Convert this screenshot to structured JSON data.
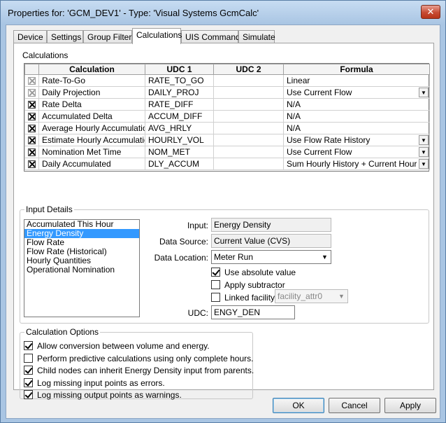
{
  "window": {
    "title": "Properties for: 'GCM_DEV1' - Type: 'Visual Systems GcmCalc'",
    "close_glyph": "✕"
  },
  "tabs": [
    {
      "label": "Device",
      "active": false
    },
    {
      "label": "Settings",
      "active": false
    },
    {
      "label": "Group Filter",
      "active": false
    },
    {
      "label": "Calculations",
      "active": true
    },
    {
      "label": "UIS Commands",
      "active": false
    },
    {
      "label": "Simulate",
      "active": false
    }
  ],
  "calculations": {
    "section_label": "Calculations",
    "columns": [
      "Calculation",
      "UDC 1",
      "UDC 2",
      "Formula"
    ],
    "rows": [
      {
        "checked": "dim",
        "calculation": "Rate-To-Go",
        "udc1": "RATE_TO_GO",
        "udc2": "",
        "formula": "Linear",
        "dropdown": false
      },
      {
        "checked": "dim",
        "calculation": "Daily Projection",
        "udc1": "DAILY_PROJ",
        "udc2": "",
        "formula": "Use Current Flow",
        "dropdown": true
      },
      {
        "checked": "on",
        "calculation": "Rate Delta",
        "udc1": "RATE_DIFF",
        "udc2": "",
        "formula": "N/A",
        "dropdown": false
      },
      {
        "checked": "on",
        "calculation": "Accumulated Delta",
        "udc1": "ACCUM_DIFF",
        "udc2": "",
        "formula": "N/A",
        "dropdown": false
      },
      {
        "checked": "on",
        "calculation": "Average Hourly Accumulation",
        "udc1": "AVG_HRLY",
        "udc2": "",
        "formula": "N/A",
        "dropdown": false
      },
      {
        "checked": "on",
        "calculation": "Estimate Hourly Accumulation",
        "udc1": "HOURLY_VOL",
        "udc2": "",
        "formula": "Use Flow Rate History",
        "dropdown": true
      },
      {
        "checked": "on",
        "calculation": "Nomination Met Time",
        "udc1": "NOM_MET",
        "udc2": "",
        "formula": "Use Current Flow",
        "dropdown": true
      },
      {
        "checked": "on",
        "calculation": "Daily Accumulated",
        "udc1": "DLY_ACCUM",
        "udc2": "",
        "formula": "Sum Hourly History + Current Hour",
        "dropdown": true
      }
    ]
  },
  "input_details": {
    "section_label": "Input Details",
    "list": [
      {
        "label": "Accumulated This Hour",
        "selected": false
      },
      {
        "label": "Energy Density",
        "selected": true
      },
      {
        "label": "Flow Rate",
        "selected": false
      },
      {
        "label": "Flow Rate (Historical)",
        "selected": false
      },
      {
        "label": "Hourly Quantities",
        "selected": false
      },
      {
        "label": "Operational Nomination",
        "selected": false
      }
    ],
    "input_label": "Input:",
    "input_value": "Energy Density",
    "data_source_label": "Data Source:",
    "data_source_value": "Current Value (CVS)",
    "data_location_label": "Data Location:",
    "data_location_value": "Meter Run",
    "use_absolute_label": "Use absolute value",
    "use_absolute_checked": true,
    "apply_subtractor_label": "Apply subtractor",
    "apply_subtractor_checked": false,
    "linked_facility_label": "Linked facility:",
    "linked_facility_checked": false,
    "linked_facility_value": "facility_attr0",
    "udc_label": "UDC:",
    "udc_value": "ENGY_DEN"
  },
  "calc_options": {
    "section_label": "Calculation Options",
    "items": [
      {
        "label": "Allow conversion between volume and energy.",
        "checked": true
      },
      {
        "label": "Perform predictive calculations using only complete hours.",
        "checked": false
      },
      {
        "label": "Child nodes can inherit Energy Density input from parents.",
        "checked": true
      },
      {
        "label": "Log missing input points as errors.",
        "checked": true
      },
      {
        "label": "Log missing output points as warnings.",
        "checked": true
      }
    ]
  },
  "buttons": {
    "ok": "OK",
    "cancel": "Cancel",
    "apply": "Apply"
  }
}
